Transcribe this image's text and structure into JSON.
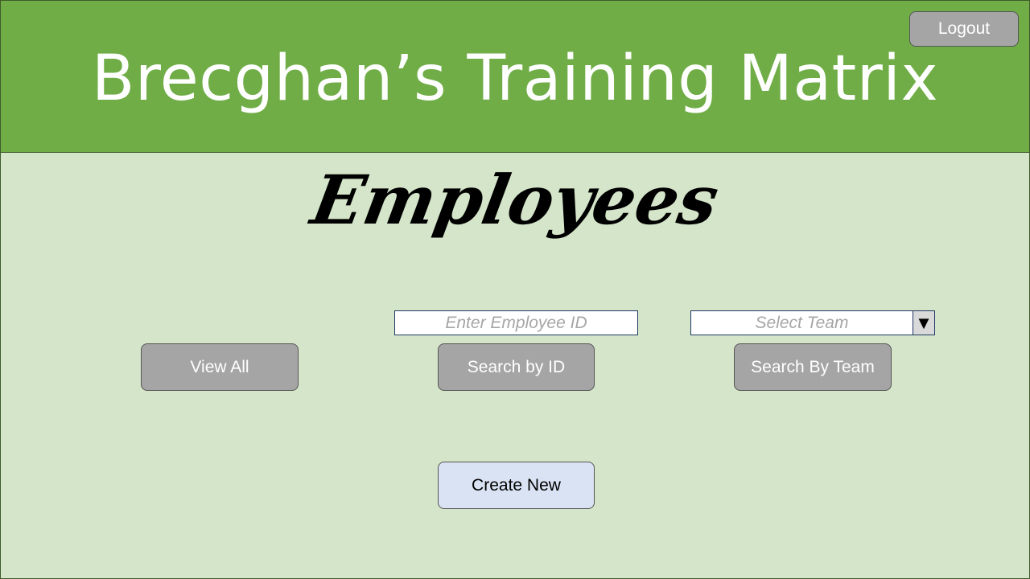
{
  "header": {
    "title": "Brecghan’s Training Matrix",
    "logout_label": "Logout"
  },
  "page": {
    "heading": "Employees"
  },
  "search": {
    "employee_id_placeholder": "Enter Employee ID",
    "team_placeholder": "Select Team",
    "team_arrow": "▼"
  },
  "actions": {
    "view_all_label": "View All",
    "search_by_id_label": "Search by ID",
    "search_by_team_label": "Search By Team",
    "create_new_label": "Create New"
  },
  "colors": {
    "header_bg": "#70ad47",
    "page_bg": "#d5e5c9",
    "button_gray": "#a5a5a5",
    "create_button_bg": "#dae3f3"
  }
}
